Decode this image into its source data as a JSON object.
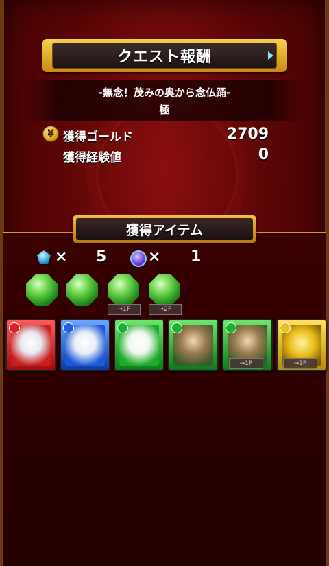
{
  "header": {
    "title": "クエスト報酬"
  },
  "quest": {
    "name": "-無念！茂みの奥から念仏踊-",
    "difficulty": "極"
  },
  "rewards": {
    "gold_label": "獲得ゴールド",
    "gold_value": "2709",
    "exp_label": "獲得経験値",
    "exp_value": "0"
  },
  "items_section": {
    "title": "獲得アイテム",
    "counters": [
      {
        "icon": "blue-shard-icon",
        "times": "×",
        "count": "5"
      },
      {
        "icon": "purple-orb-icon",
        "times": "×",
        "count": "1"
      }
    ],
    "gem_tags": [
      "→1P",
      "→2P"
    ],
    "card_tags": [
      "→1P",
      "→2P"
    ]
  },
  "colors": {
    "background": "#5a0505",
    "gold_frame": "#e0a830",
    "green_gem": "#3cb832",
    "card_red": "#c81e1e",
    "card_blue": "#1e5ad8",
    "card_green": "#1eaa2a",
    "card_yellow": "#e8b818"
  }
}
